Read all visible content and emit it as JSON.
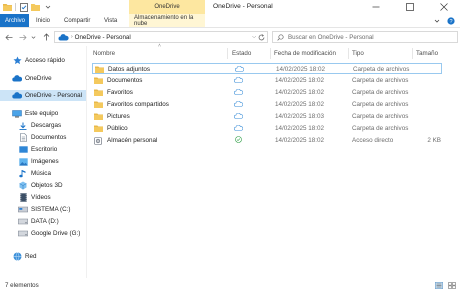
{
  "window": {
    "title": "OneDrive - Personal",
    "context_tab": "OneDrive"
  },
  "ribbon": {
    "tabs": [
      {
        "label": "Archivo"
      },
      {
        "label": "Inicio"
      },
      {
        "label": "Compartir"
      },
      {
        "label": "Vista"
      },
      {
        "label": "Almacenamiento en la nube"
      }
    ]
  },
  "address": {
    "breadcrumb": "OneDrive - Personal",
    "search_placeholder": "Buscar en OneDrive - Personal"
  },
  "navpane": {
    "items": [
      {
        "label": "Acceso rápido",
        "icon": "pin-star-icon"
      },
      {
        "label": "OneDrive",
        "icon": "cloud-icon"
      },
      {
        "label": "OneDrive - Personal",
        "icon": "cloud-icon",
        "selected": true
      },
      {
        "label": "Este equipo",
        "icon": "computer-icon"
      },
      {
        "label": "Descargas",
        "icon": "download-icon"
      },
      {
        "label": "Documentos",
        "icon": "document-icon"
      },
      {
        "label": "Escritorio",
        "icon": "desktop-icon"
      },
      {
        "label": "Imágenes",
        "icon": "pictures-icon"
      },
      {
        "label": "Música",
        "icon": "music-icon"
      },
      {
        "label": "Objetos 3D",
        "icon": "cube-icon"
      },
      {
        "label": "Vídeos",
        "icon": "video-icon"
      },
      {
        "label": "SISTEMA (C:)",
        "icon": "drive-icon"
      },
      {
        "label": "DATA (D:)",
        "icon": "drive-icon"
      },
      {
        "label": "Google Drive (G:)",
        "icon": "google-drive-icon"
      },
      {
        "label": "Red",
        "icon": "network-icon"
      }
    ]
  },
  "columns": {
    "name": "Nombre",
    "status": "Estado",
    "modified": "Fecha de modificación",
    "type": "Tipo",
    "size": "Tamaño"
  },
  "files": [
    {
      "name": "Datos adjuntos",
      "status": "cloud",
      "modified": "14/02/2025 18:02",
      "type": "Carpeta de archivos",
      "size": "",
      "icon": "folder-icon"
    },
    {
      "name": "Documentos",
      "status": "cloud",
      "modified": "14/02/2025 18:02",
      "type": "Carpeta de archivos",
      "size": "",
      "icon": "folder-icon"
    },
    {
      "name": "Favoritos",
      "status": "cloud",
      "modified": "14/02/2025 18:02",
      "type": "Carpeta de archivos",
      "size": "",
      "icon": "folder-icon"
    },
    {
      "name": "Favoritos compartidos",
      "status": "cloud",
      "modified": "14/02/2025 18:02",
      "type": "Carpeta de archivos",
      "size": "",
      "icon": "folder-icon"
    },
    {
      "name": "Pictures",
      "status": "cloud",
      "modified": "14/02/2025 18:03",
      "type": "Carpeta de archivos",
      "size": "",
      "icon": "folder-icon"
    },
    {
      "name": "Público",
      "status": "cloud",
      "modified": "14/02/2025 18:02",
      "type": "Carpeta de archivos",
      "size": "",
      "icon": "folder-icon"
    },
    {
      "name": "Almacén personal",
      "status": "synced",
      "modified": "14/02/2025 18:02",
      "type": "Acceso directo",
      "size": "2 KB",
      "icon": "vault-icon"
    }
  ],
  "status": {
    "item_count": "7 elementos"
  },
  "colors": {
    "accent": "#1a73c8",
    "folder": "#f4c95d",
    "selection": "#cce4f7",
    "context_tab": "#fde7a0",
    "cloud_status": "#3b8ed8",
    "synced_status": "#2e9e45"
  }
}
